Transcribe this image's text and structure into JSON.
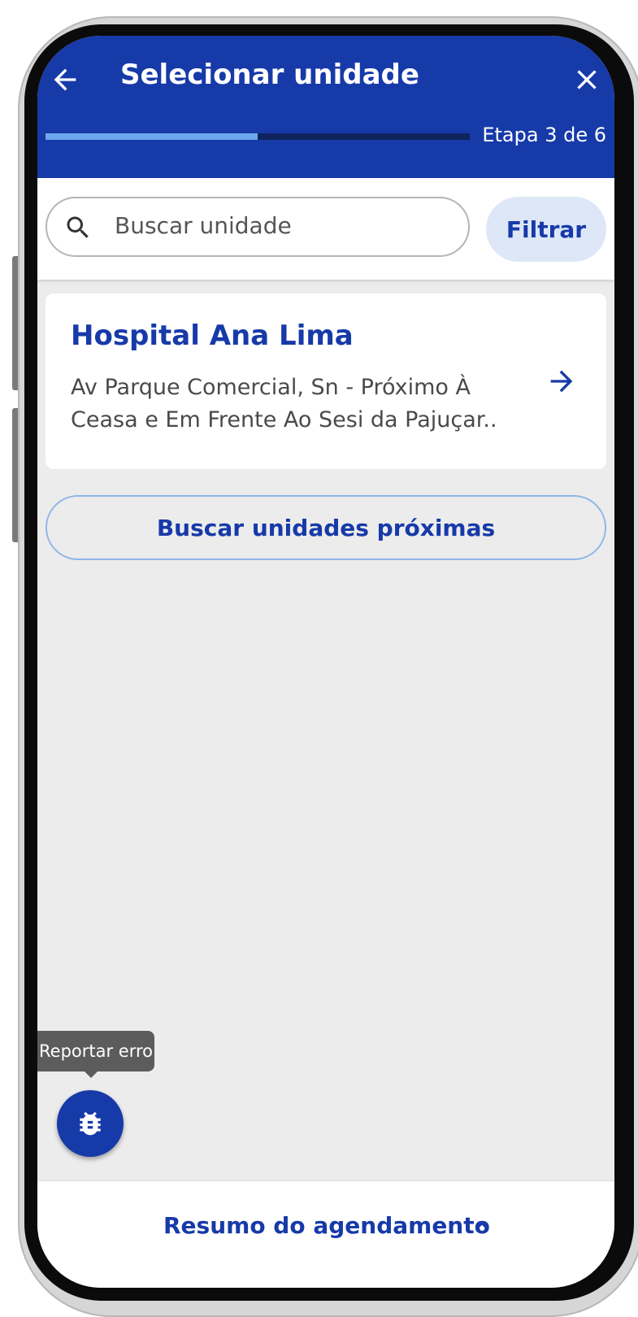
{
  "header": {
    "title": "Selecionar unidade",
    "step": "Etapa 3 de 6",
    "progress": 0.5,
    "colors": {
      "primary": "#173aa9",
      "progress_fill": "#6fa7ef",
      "progress_track": "#0f235c"
    }
  },
  "search": {
    "placeholder": "Buscar unidade",
    "filter_label": "Filtrar"
  },
  "results": [
    {
      "name": "Hospital Ana Lima",
      "address": "Av Parque Comercial, Sn - Próximo À Ceasa e Em Frente Ao Sesi da Pajuçar.."
    }
  ],
  "nearby_label": "Buscar unidades próximas",
  "report": {
    "tooltip": "Reportar erro",
    "icon": "bug-icon"
  },
  "summary": {
    "label": "Resumo do agendamento",
    "icon": "chevron-up-icon"
  }
}
